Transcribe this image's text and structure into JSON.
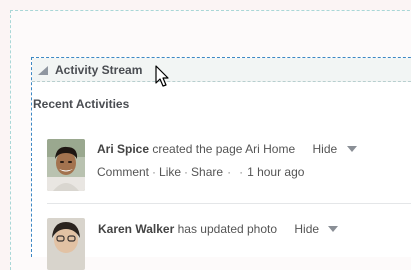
{
  "portlet": {
    "title": "Activity Stream"
  },
  "section": {
    "heading": "Recent Activities"
  },
  "activities": [
    {
      "user": "Ari Spice",
      "action": "created the page Ari Home",
      "hide_label": "Hide",
      "comment_label": "Comment",
      "like_label": "Like",
      "share_label": "Share",
      "timestamp": "1 hour ago"
    },
    {
      "user": "Karen Walker",
      "action": "has updated photo",
      "hide_label": "Hide"
    }
  ],
  "icons": {
    "collapse": "collapse-triangle-icon",
    "cursor": "mouse-pointer-icon",
    "hide_menu": "chevron-down-icon"
  },
  "colors": {
    "portlet_border": "#3d88c4",
    "outer_border": "#a9d7d7",
    "header_bg": "#f2f5f4"
  }
}
